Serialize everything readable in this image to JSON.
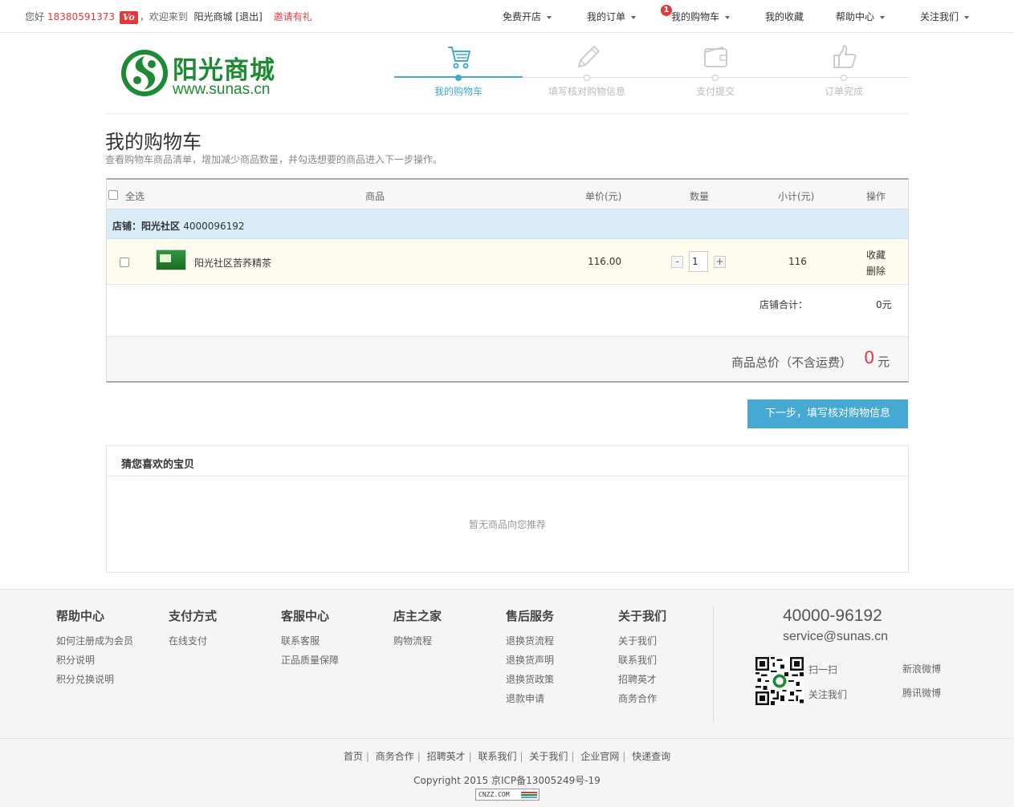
{
  "topbar": {
    "greeting": "您好",
    "phone": "18380591373",
    "vip_badge": "Vo",
    "welcome": "，欢迎来到",
    "site_name": "阳光商城",
    "logout": "[退出]",
    "invite": "邀请有礼",
    "menu": [
      {
        "label": "免费开店",
        "has_caret": true
      },
      {
        "label": "我的订单",
        "has_caret": true
      },
      {
        "label": "我的购物车",
        "has_caret": true,
        "badge": "1"
      },
      {
        "label": "我的收藏",
        "has_caret": false
      },
      {
        "label": "帮助中心",
        "has_caret": true
      },
      {
        "label": "关注我们",
        "has_caret": true
      }
    ]
  },
  "logo": {
    "name": "阳光商城",
    "url": "www.sunas.cn"
  },
  "steps": [
    {
      "label": "我的购物车",
      "active": true,
      "icon": "cart-icon"
    },
    {
      "label": "填写核对购物信息",
      "active": false,
      "icon": "pencil-icon"
    },
    {
      "label": "支付提交",
      "active": false,
      "icon": "wallet-icon"
    },
    {
      "label": "订单完成",
      "active": false,
      "icon": "thumbs-up-icon"
    }
  ],
  "page": {
    "title": "我的购物车",
    "subtitle": "查看购物车商品清单，增加减少商品数量，并勾选想要的商品进入下一步操作。"
  },
  "cart": {
    "headers": {
      "select_all": "全选",
      "product": "商品",
      "unit_price": "单价(元)",
      "quantity": "数量",
      "subtotal": "小计(元)",
      "action": "操作"
    },
    "shop": {
      "label": "店铺：阳光社区",
      "phone": "4000096192"
    },
    "items": [
      {
        "name": "阳光社区苦荞精茶",
        "price": "116.00",
        "quantity": "1",
        "subtotal": "116",
        "fav": "收藏",
        "delete": "删除"
      }
    ],
    "shop_total_label": "店铺合计：",
    "shop_total": "0元",
    "grand_total_label": "商品总价（不含运费）",
    "grand_total": "0",
    "currency": "元",
    "minus": "-",
    "plus": "+"
  },
  "next_button": "下一步，填写核对购物信息",
  "guess": {
    "title": "猜您喜欢的宝贝",
    "empty": "暂无商品向您推荐"
  },
  "footer": {
    "columns": [
      {
        "title": "帮助中心",
        "links": [
          "如何注册成为会员",
          "积分说明",
          "积分兑换说明"
        ]
      },
      {
        "title": "支付方式",
        "links": [
          "在线支付"
        ]
      },
      {
        "title": "客服中心",
        "links": [
          "联系客服",
          "正品质量保障"
        ]
      },
      {
        "title": "店主之家",
        "links": [
          "购物流程"
        ]
      },
      {
        "title": "售后服务",
        "links": [
          "退换货流程",
          "退换货声明",
          "退换货政策",
          "退款申请"
        ]
      },
      {
        "title": "关于我们",
        "links": [
          "关于我们",
          "联系我们",
          "招聘英才",
          "商务合作"
        ]
      }
    ],
    "phone": "40000-96192",
    "email": "service@sunas.cn",
    "scan": "扫一扫",
    "follow": "关注我们",
    "weibo_sina": "新浪微博",
    "weibo_tencent": "腾讯微博"
  },
  "bottom": {
    "links": [
      "首页",
      "商务合作",
      "招聘英才",
      "联系我们",
      "关于我们",
      "企业官网",
      "快递查询"
    ],
    "copyright": "Copyright 2015 京ICP备13005249号-19",
    "cnzz": "CNZZ.COM"
  },
  "colors": {
    "accent": "#46a9d3",
    "brand_green": "#1e8a33",
    "price_red": "#e4393c"
  }
}
